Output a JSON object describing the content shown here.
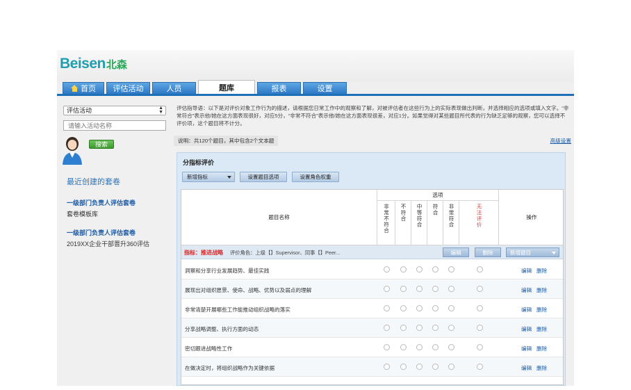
{
  "app": {
    "logo_en": "Beisen",
    "logo_cn": "北森"
  },
  "tabs": [
    {
      "label": "首页",
      "active": false
    },
    {
      "label": "评估活动",
      "active": false
    },
    {
      "label": "人员",
      "active": false
    },
    {
      "label": "题库",
      "active": true
    },
    {
      "label": "报表",
      "active": false
    },
    {
      "label": "设置",
      "active": false
    }
  ],
  "sidebar": {
    "select_value": "评估活动",
    "search_placeholder": "请输入活动名称",
    "search_button": "搜索",
    "recent_title": "最近创建的套卷",
    "recent": [
      {
        "title": "一级部门负责人评估套卷",
        "sub": "套卷模板库"
      },
      {
        "title": "一级部门负责人评估套卷",
        "sub": "2019XX企业干部晋升360评估"
      }
    ]
  },
  "main": {
    "guide_text": "评估指导语：以下是对评价对象工作行为的描述，请根据您日常工作中的观察和了解，对被评估者在这些行为上的实际表现做出判断，并选择相应的选项或填入文字。“非常符合”表示他/她在这方面表现很好，对应5分，“非常不符合”表示他/她在这方面表现很差，对应1分。如果觉得对某些题目所代表的行为缺乏足够的观察，您可以选择不评价项，这个题目将不计分。",
    "summary": "说明：共120个题目，其中包含2个文本题",
    "advanced_link": "高级设置",
    "panel_title": "分指标评价",
    "toolbar": {
      "add_indicator": "新增指标",
      "set_options": "设置题目选项",
      "set_role_weight": "设置角色权重"
    },
    "table": {
      "col_question": "题目名称",
      "col_options": "选项",
      "col_ops": "操作",
      "options": [
        "非常不符合",
        "不符合",
        "中等符合",
        "符合",
        "非常符合",
        "无法评价"
      ]
    },
    "indicator": {
      "label": "指标：推进战略",
      "roles": "评价角色：上级【】Supervisor、同事【】Peer...",
      "edit": "编辑",
      "delete": "删除",
      "add_question": "新增题目"
    },
    "questions": [
      {
        "text": "洞察和分享行业发展趋势、最佳实践",
        "edit": "编辑",
        "delete": "删除"
      },
      {
        "text": "展现出对组织愿景、使命、战略、优势以及弱点的理解",
        "edit": "编辑",
        "delete": "删除"
      },
      {
        "text": "非常清楚开展哪些工作能推动组织战略的落实",
        "edit": "编辑",
        "delete": "删除"
      },
      {
        "text": "分享战略调整、执行方面的动态",
        "edit": "编辑",
        "delete": "删除"
      },
      {
        "text": "密切跟进战略性工作",
        "edit": "编辑",
        "delete": "删除"
      },
      {
        "text": "在做决定时，将组织战略作为关键依据",
        "edit": "编辑",
        "delete": "删除"
      }
    ]
  }
}
